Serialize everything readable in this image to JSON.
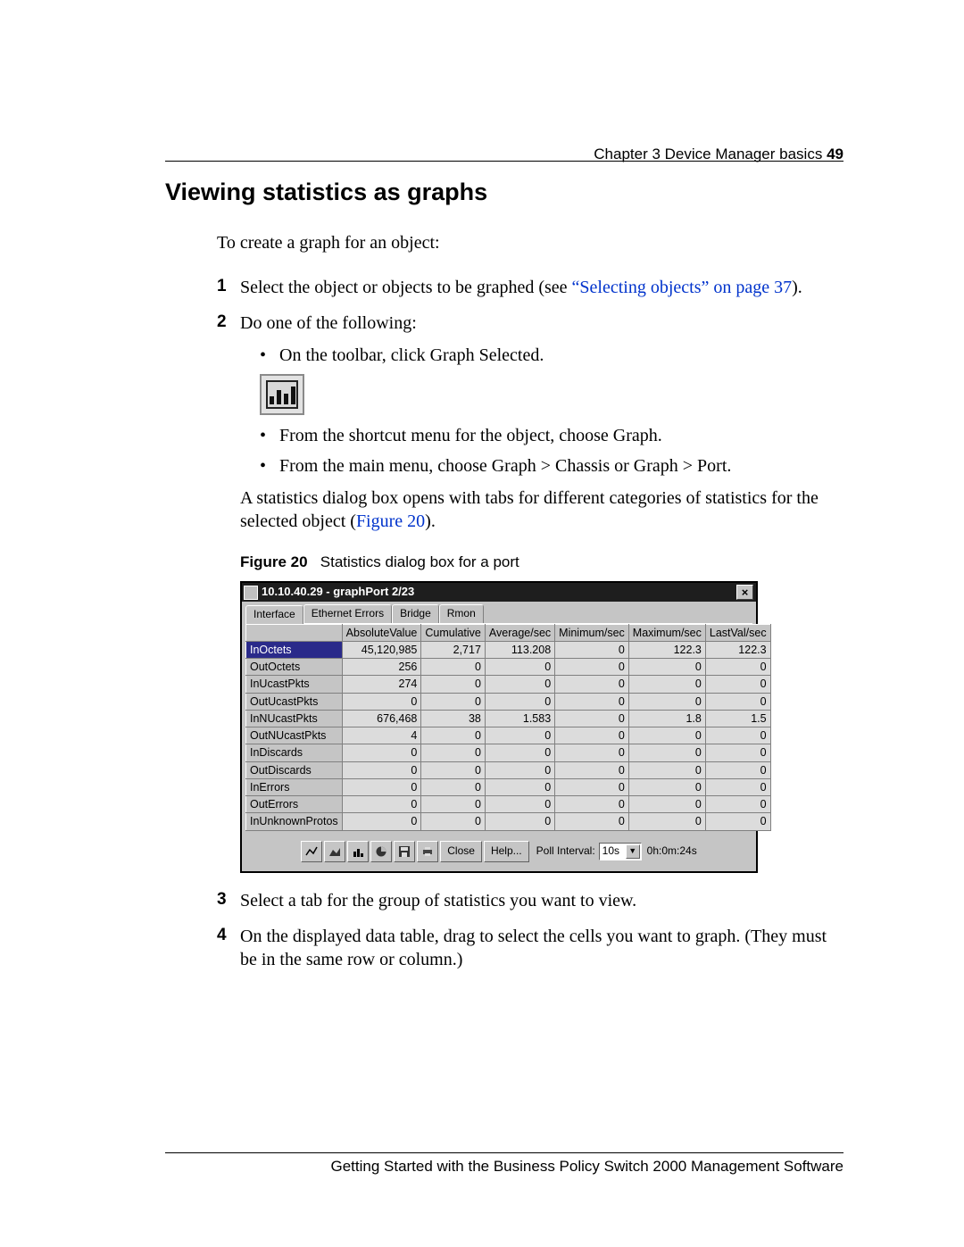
{
  "header": {
    "chapter": "Chapter 3  Device Manager basics",
    "page_number": "49"
  },
  "title": "Viewing statistics as graphs",
  "intro": "To create a graph for an object:",
  "steps": {
    "s1_a": "Select the object or objects to be graphed (see ",
    "s1_link": "“Selecting objects” on page 37",
    "s1_b": ").",
    "s2": "Do one of the following:",
    "s2_b1": "On the toolbar, click Graph Selected.",
    "s2_b2": "From the shortcut menu for the object, choose Graph.",
    "s2_b3": "From the main menu, choose Graph > Chassis or Graph > Port.",
    "s2_note_a": "A statistics dialog box opens with tabs for different categories of statistics for the selected object (",
    "s2_note_link": "Figure 20",
    "s2_note_b": ").",
    "s3": "Select a tab for the group of statistics you want to view.",
    "s4": "On the displayed data table, drag to select the cells you want to graph. (They must be in the same row or column.)"
  },
  "figure": {
    "label": "Figure 20",
    "caption": "Statistics dialog box for a port"
  },
  "dialog": {
    "title": "10.10.40.29 - graphPort 2/23",
    "tabs": [
      "Interface",
      "Ethernet Errors",
      "Bridge",
      "Rmon"
    ],
    "columns": [
      "AbsoluteValue",
      "Cumulative",
      "Average/sec",
      "Minimum/sec",
      "Maximum/sec",
      "LastVal/sec"
    ],
    "rows": [
      {
        "name": "InOctets",
        "v": [
          "45,120,985",
          "2,717",
          "113.208",
          "0",
          "122.3",
          "122.3"
        ],
        "selected": true
      },
      {
        "name": "OutOctets",
        "v": [
          "256",
          "0",
          "0",
          "0",
          "0",
          "0"
        ]
      },
      {
        "name": "InUcastPkts",
        "v": [
          "274",
          "0",
          "0",
          "0",
          "0",
          "0"
        ]
      },
      {
        "name": "OutUcastPkts",
        "v": [
          "0",
          "0",
          "0",
          "0",
          "0",
          "0"
        ]
      },
      {
        "name": "InNUcastPkts",
        "v": [
          "676,468",
          "38",
          "1.583",
          "0",
          "1.8",
          "1.5"
        ]
      },
      {
        "name": "OutNUcastPkts",
        "v": [
          "4",
          "0",
          "0",
          "0",
          "0",
          "0"
        ]
      },
      {
        "name": "InDiscards",
        "v": [
          "0",
          "0",
          "0",
          "0",
          "0",
          "0"
        ]
      },
      {
        "name": "OutDiscards",
        "v": [
          "0",
          "0",
          "0",
          "0",
          "0",
          "0"
        ]
      },
      {
        "name": "InErrors",
        "v": [
          "0",
          "0",
          "0",
          "0",
          "0",
          "0"
        ]
      },
      {
        "name": "OutErrors",
        "v": [
          "0",
          "0",
          "0",
          "0",
          "0",
          "0"
        ]
      },
      {
        "name": "InUnknownProtos",
        "v": [
          "0",
          "0",
          "0",
          "0",
          "0",
          "0"
        ]
      }
    ],
    "buttons": {
      "close": "Close",
      "help": "Help..."
    },
    "poll_label": "Poll Interval:",
    "poll_value": "10s",
    "elapsed": "0h:0m:24s"
  },
  "step_numbers": {
    "n1": "1",
    "n2": "2",
    "n3": "3",
    "n4": "4"
  },
  "footer": "Getting Started with the Business Policy Switch 2000 Management Software"
}
